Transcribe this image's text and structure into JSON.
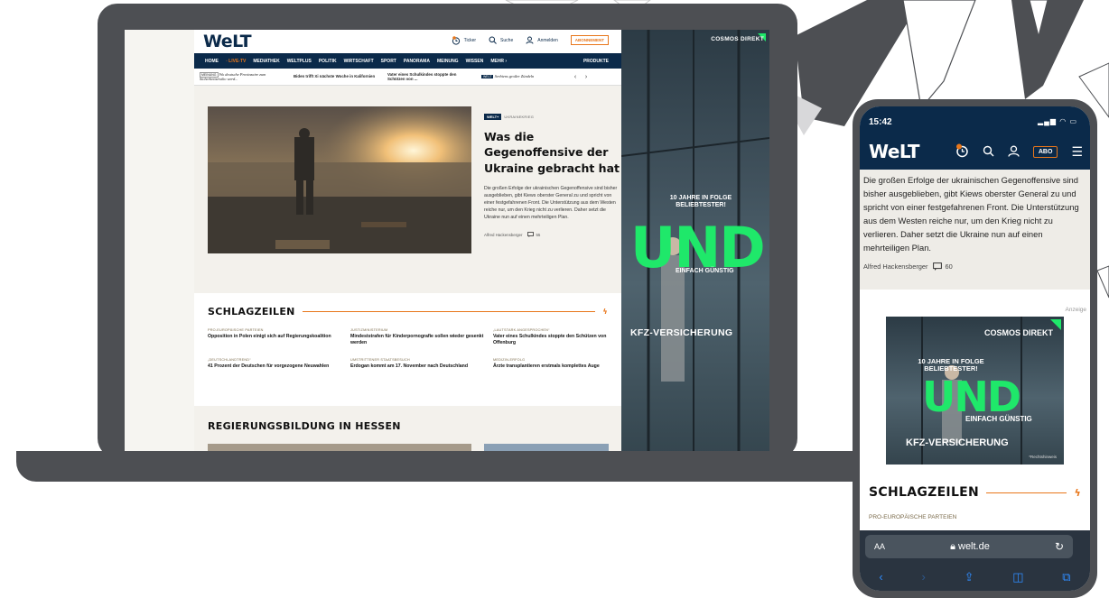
{
  "colors": {
    "welt_navy": "#0b2a4a",
    "welt_orange": "#e8761a",
    "ad_green": "#1fe86a",
    "device_frame": "#4d4f53"
  },
  "laptop": {
    "header": {
      "logo": "WeLT",
      "ticker_label": "Ticker",
      "search_label": "Suche",
      "login_label": "Anmelden",
      "subscription_label": "ABONNEMENT"
    },
    "nav": {
      "items": [
        "HOME",
        "LIVE-TV",
        "MEDIATHEK",
        "WELTPLUS",
        "POLITIK",
        "WIRTSCHAFT",
        "SPORT",
        "PANORAMA",
        "MEINUNG",
        "WISSEN",
        "MEHR"
      ],
      "products": "PRODUKTE"
    },
    "ticker": [
      {
        "tag": "MEINUNG",
        "text": "Wo deutsche Provinzaire zum Sicherheitsrisiko werd..."
      },
      {
        "tag": "",
        "text": "Biden trifft Xi nächste Woche in Kalifornien"
      },
      {
        "tag": "",
        "text": "Vater eines Schulkindes stoppte den Schützen von ..."
      },
      {
        "tag": "WELT",
        "text": "Serbiens großer Zündeln"
      }
    ],
    "hero": {
      "badge": "WELT+",
      "rubric": "UKRAINEKRIEG",
      "title": "Was die Gegenoffensive der Ukraine gebracht hat",
      "teaser": "Die großen Erfolge der ukrainischen Gegenoffensive sind bisher ausgeblieben, gibt Kiews oberster General zu und spricht von einer festgefahrenen Front. Die Unterstützung aus dem Westen reiche nur, um den Krieg nicht zu verlieren. Daher setzt die Ukraine nun auf einen mehrteiligen Plan.",
      "author": "Alfred Hackensberger",
      "comments": "55"
    },
    "schlagzeilen": {
      "title": "SCHLAGZEILEN",
      "items": [
        {
          "kicker": "PRO-EUROPÄISCHE PARTEIEN",
          "headline": "Opposition in Polen einigt sich auf Regierungskoalition"
        },
        {
          "kicker": "JUSTIZMINISTERIUM",
          "headline": "Mindeststrafen für Kinderpornografie sollen wieder gesenkt werden"
        },
        {
          "kicker": "„LAUTSTARK ANGESPROCHEN“",
          "headline": "Vater eines Schulkindes stoppte den Schützen von Offenburg"
        },
        {
          "kicker": "„DEUTSCHLANDTREND“",
          "headline": "41 Prozent der Deutschen für vorgezogene Neuwahlen"
        },
        {
          "kicker": "UMSTRITTENER STAATSBESUCH",
          "headline": "Erdogan kommt am 17. November nach Deutschland"
        },
        {
          "kicker": "MEDIZIN-ERFOLG",
          "headline": "Ärzte transplantieren erstmals komplettes Auge"
        }
      ]
    },
    "section2_title": "REGIERUNGSBILDUNG IN HESSEN",
    "ad": {
      "brand": "COSMOS DIREKT",
      "years": "10 JAHRE IN FOLGE BELIEBTESTER!",
      "big": "UND",
      "simple": "EINFACH GÜNSTIG",
      "product": "KFZ-VERSICHERUNG"
    }
  },
  "phone": {
    "time": "15:42",
    "logo": "WeLT",
    "abo_label": "ABO",
    "teaser": "Die großen Erfolge der ukrainischen Gegenoffensive sind bisher ausgeblieben, gibt Kiews oberster General zu und spricht von einer festgefahrenen Front. Die Unterstützung aus dem Westen reiche nur, um den Krieg nicht zu verlieren. Daher setzt die Ukraine nun auf einen mehrteiligen Plan.",
    "author": "Alfred Hackensberger",
    "comments": "60",
    "ad_label": "Anzeige",
    "ad": {
      "brand": "COSMOS DIREKT",
      "years": "10 JAHRE IN FOLGE BELIEBTESTER!",
      "big": "UND",
      "simple": "EINFACH GÜNSTIG",
      "product": "KFZ-VERSICHERUNG",
      "note": "*Rechtshinweis"
    },
    "schlagzeilen_title": "SCHLAGZEILEN",
    "first_kicker": "PRO-EUROPÄISCHE PARTEIEN",
    "browser": {
      "text_size": "AA",
      "host": "welt.de"
    }
  }
}
